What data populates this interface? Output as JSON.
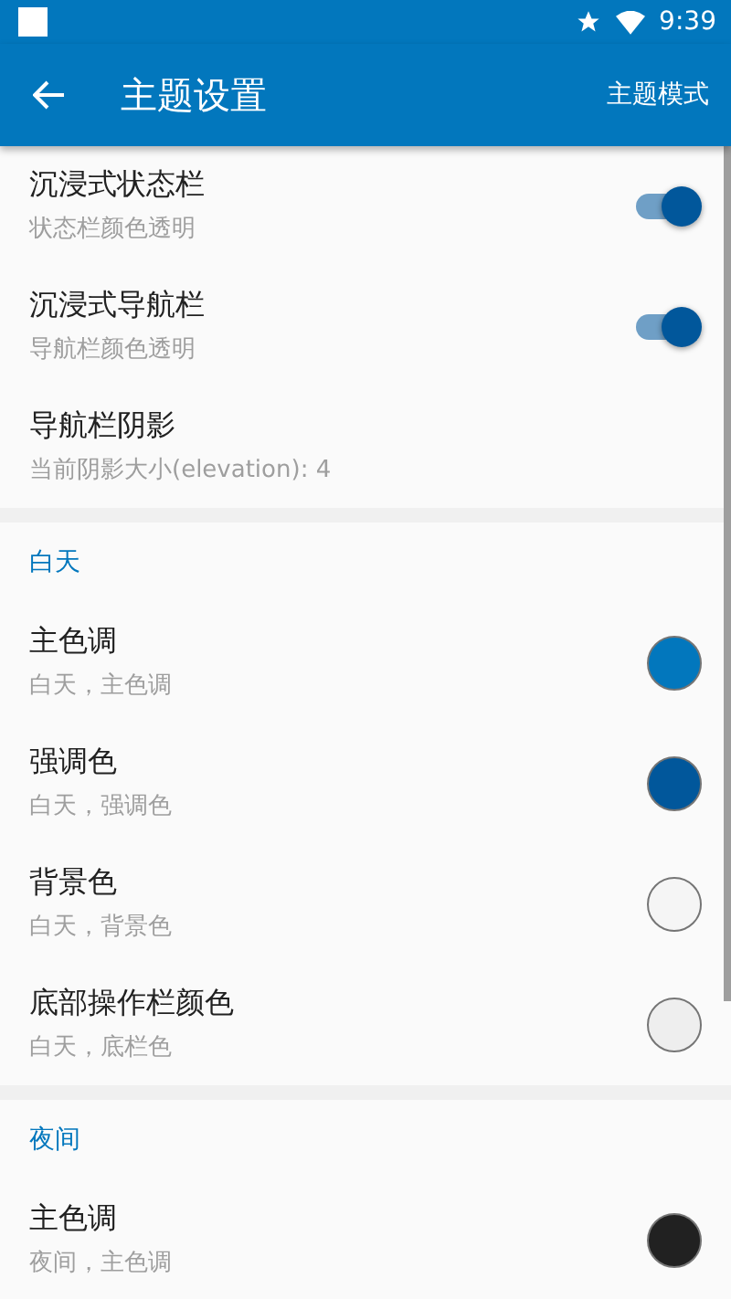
{
  "status_bar": {
    "time": "9:39"
  },
  "app_bar": {
    "title": "主题设置",
    "action": "主题模式"
  },
  "sections": [
    {
      "items": [
        {
          "kind": "switch",
          "title": "沉浸式状态栏",
          "subtitle": "状态栏颜色透明",
          "on": true
        },
        {
          "kind": "switch",
          "title": "沉浸式导航栏",
          "subtitle": "导航栏颜色透明",
          "on": true
        },
        {
          "kind": "plain",
          "title": "导航栏阴影",
          "subtitle": "当前阴影大小(elevation): 4"
        }
      ]
    },
    {
      "header": "白天",
      "items": [
        {
          "kind": "color",
          "title": "主色调",
          "subtitle": "白天，主色调",
          "color": "#0277bd"
        },
        {
          "kind": "color",
          "title": "强调色",
          "subtitle": "白天，强调色",
          "color": "#01579b"
        },
        {
          "kind": "color",
          "title": "背景色",
          "subtitle": "白天，背景色",
          "color": "#f5f5f5"
        },
        {
          "kind": "color",
          "title": "底部操作栏颜色",
          "subtitle": "白天，底栏色",
          "color": "#eeeeee"
        }
      ]
    },
    {
      "header": "夜间",
      "items": [
        {
          "kind": "color",
          "title": "主色调",
          "subtitle": "夜间，主色调",
          "color": "#212121"
        }
      ]
    }
  ]
}
